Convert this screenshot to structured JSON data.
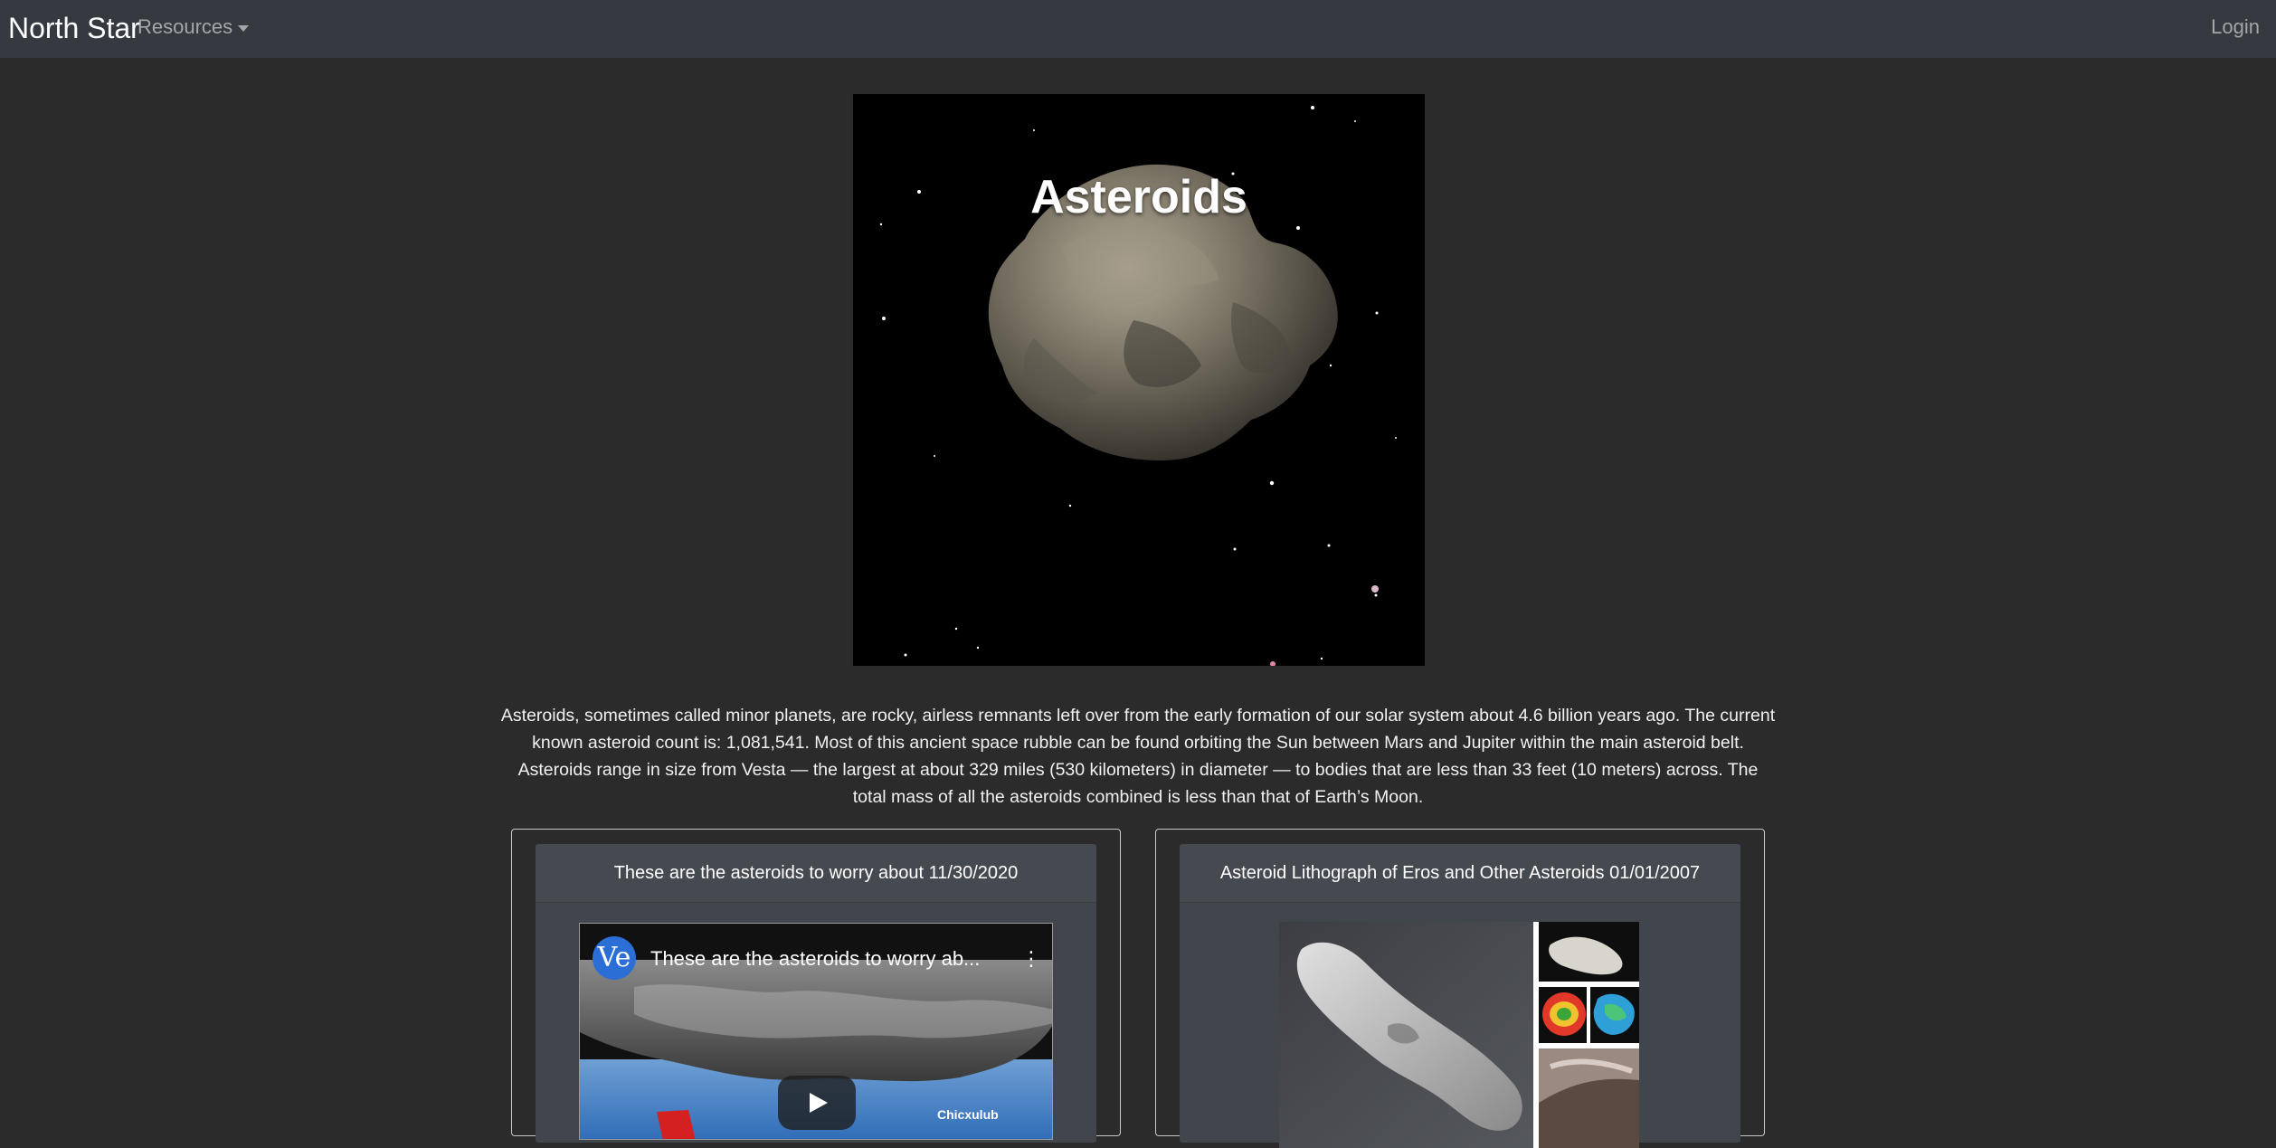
{
  "navbar": {
    "brand": "North Star",
    "resources_label": "Resources",
    "login_label": "Login"
  },
  "hero": {
    "title": "Asteroids"
  },
  "description": "Asteroids, sometimes called minor planets, are rocky, airless remnants left over from the early formation of our solar system about 4.6 billion years ago. The current known asteroid count is: 1,081,541. Most of this ancient space rubble can be found orbiting the Sun between Mars and Jupiter within the main asteroid belt. Asteroids range in size from Vesta — the largest at about 329 miles (530 kilometers) in diameter — to bodies that are less than 33 feet (10 meters) across. The total mass of all the asteroids combined is less than that of Earth’s Moon.",
  "cards": [
    {
      "header": "These are the asteroids to worry about 11/30/2020",
      "video": {
        "channel_initials": "Ve",
        "title": "These are the asteroids to worry ab...",
        "caption": "Chicxulub"
      }
    },
    {
      "header": "Asteroid Lithograph of Eros and Other Asteroids 01/01/2007"
    }
  ],
  "colors": {
    "page_background": "#2b2b2c",
    "navbar_background": "#343a40",
    "card_inner_background": "#41464c"
  }
}
